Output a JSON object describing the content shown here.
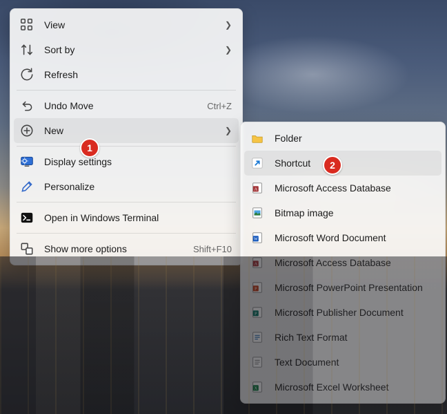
{
  "menu1": {
    "view": {
      "label": "View"
    },
    "sort": {
      "label": "Sort by"
    },
    "refresh": {
      "label": "Refresh"
    },
    "undo": {
      "label": "Undo Move",
      "accel": "Ctrl+Z"
    },
    "new": {
      "label": "New"
    },
    "display": {
      "label": "Display settings"
    },
    "personalize": {
      "label": "Personalize"
    },
    "terminal": {
      "label": "Open in Windows Terminal"
    },
    "more": {
      "label": "Show more options",
      "accel": "Shift+F10"
    }
  },
  "menu2": {
    "folder": {
      "label": "Folder"
    },
    "shortcut": {
      "label": "Shortcut"
    },
    "access1": {
      "label": "Microsoft Access Database"
    },
    "bitmap": {
      "label": "Bitmap image"
    },
    "word": {
      "label": "Microsoft Word Document"
    },
    "access2": {
      "label": "Microsoft Access Database"
    },
    "ppt": {
      "label": "Microsoft PowerPoint Presentation"
    },
    "pub": {
      "label": "Microsoft Publisher Document"
    },
    "rtf": {
      "label": "Rich Text Format"
    },
    "txt": {
      "label": "Text Document"
    },
    "excel": {
      "label": "Microsoft Excel Worksheet"
    }
  },
  "badges": {
    "one": "1",
    "two": "2"
  }
}
